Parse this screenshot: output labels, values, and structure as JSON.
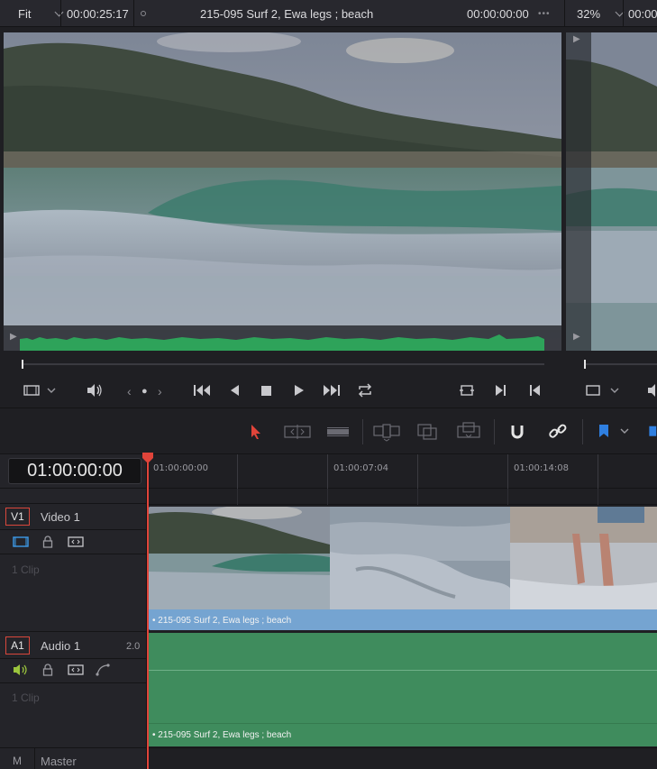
{
  "topbar": {
    "zoom_left": "Fit",
    "timecode_left": "00:00:25:17",
    "clip_title": "215-095 Surf 2, Ewa legs ; beach",
    "timecode_center": "00:00:00:00",
    "more": "•••",
    "zoom_right": "32%",
    "timecode_right": "00:00"
  },
  "timeline": {
    "timecode": "01:00:00:00",
    "ruler": [
      "01:00:00:00",
      "01:00:07:04",
      "01:00:14:08"
    ]
  },
  "tracks": {
    "video": {
      "badge": "V1",
      "name": "Video 1",
      "clips": "1 Clip",
      "clip_label": "215-095 Surf 2, Ewa legs ; beach"
    },
    "audio": {
      "badge": "A1",
      "name": "Audio 1",
      "level": "2.0",
      "clips": "1 Clip",
      "clip_label": "215-095 Surf 2, Ewa legs ; beach"
    },
    "master": {
      "badge": "M",
      "name": "Master"
    }
  },
  "colors": {
    "playhead": "#e0443a",
    "video_clip": "#75a4d1",
    "audio_clip": "#3f8c5d",
    "waveform": "#2ea35a",
    "select_tool": "#e0443a",
    "marker": "#2f7fe0"
  },
  "icons": [
    "monitor-icon",
    "speaker-icon",
    "prev-clip-icon",
    "jog-dot-icon",
    "next-clip-icon",
    "skip-start-icon",
    "play-reverse-icon",
    "stop-icon",
    "play-icon",
    "skip-end-icon",
    "loop-icon",
    "match-frame-icon",
    "in-point-icon",
    "out-point-icon",
    "select-tool-icon",
    "trim-tool-icon",
    "blade-tool-icon",
    "insert-icon",
    "overwrite-icon",
    "replace-icon",
    "snap-icon",
    "link-icon",
    "marker-flag-icon",
    "lock-icon",
    "auto-select-icon",
    "curve-icon"
  ]
}
